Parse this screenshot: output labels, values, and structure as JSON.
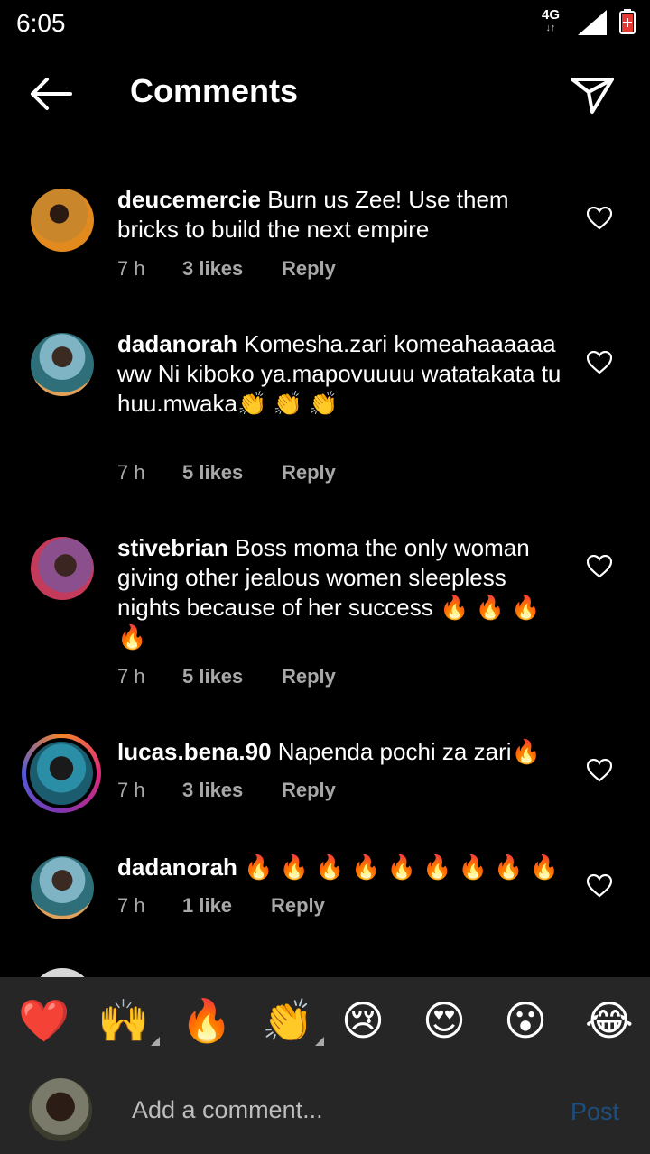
{
  "status": {
    "time": "6:05",
    "network": "4G"
  },
  "header": {
    "title": "Comments"
  },
  "comments": [
    {
      "user": "deucemercie",
      "text": "Burn us Zee! Use them bricks to build the next empire",
      "time": "7 h",
      "likes": "3 likes",
      "reply": "Reply"
    },
    {
      "user": "dadanorah",
      "text": "Komesha.zari komeahaaaaaa ww Ni kiboko ya.mapovuuuu  watatakata tu huu.mwaka👏 👏 👏",
      "time": "7 h",
      "likes": "5 likes",
      "reply": "Reply"
    },
    {
      "user": "stivebrian",
      "text": "Boss moma the only woman giving other jealous women sleepless nights because of her success 🔥 🔥 🔥 🔥",
      "time": "7 h",
      "likes": "5 likes",
      "reply": "Reply"
    },
    {
      "user": "lucas.bena.90",
      "text": "Napenda pochi za zari🔥",
      "time": "7 h",
      "likes": "3 likes",
      "reply": "Reply"
    },
    {
      "user": "dadanorah",
      "text": "🔥 🔥 🔥 🔥 🔥 🔥 🔥 🔥 🔥",
      "time": "7 h",
      "likes": "1 like",
      "reply": "Reply"
    }
  ],
  "reactions": [
    "❤️",
    "🙌",
    "🔥",
    "👏",
    "😢",
    "😍",
    "😮",
    "😂"
  ],
  "composer": {
    "placeholder": "Add a comment...",
    "post_label": "Post"
  },
  "colors": {
    "background": "#000000",
    "panel": "#262626",
    "meta": "#a8a8a8",
    "post_disabled": "#1c4f80"
  }
}
